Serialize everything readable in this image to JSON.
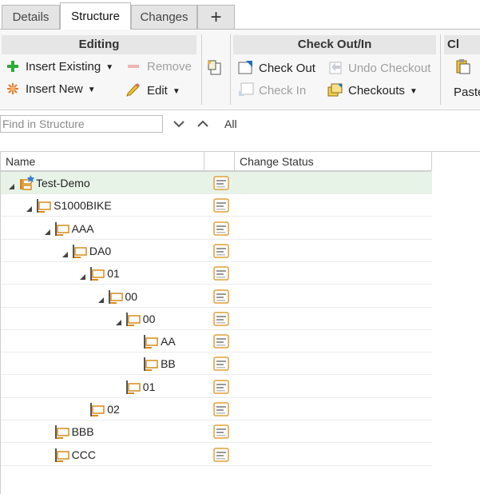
{
  "tabs": [
    {
      "label": "Details"
    },
    {
      "label": "Structure",
      "active": true
    },
    {
      "label": "Changes"
    },
    {
      "label": "+"
    }
  ],
  "ribbon": {
    "editing": {
      "title": "Editing",
      "insert_existing": "Insert Existing",
      "insert_new": "Insert New",
      "remove": "Remove",
      "edit": "Edit"
    },
    "checkout": {
      "title": "Check Out/In",
      "check_out": "Check Out",
      "check_in": "Check In",
      "undo_checkout": "Undo Checkout",
      "checkouts": "Checkouts"
    },
    "clipboard": {
      "title": "Cl",
      "paste": "Paste"
    }
  },
  "find": {
    "placeholder": "Find in Structure",
    "scope": "All"
  },
  "grid": {
    "columns": {
      "name": "Name",
      "change_status": "Change Status"
    },
    "rows": [
      {
        "label": "Test-Demo",
        "level": 0,
        "expanded": true,
        "root": true
      },
      {
        "label": "S1000BIKE",
        "level": 1,
        "expanded": true
      },
      {
        "label": "AAA",
        "level": 2,
        "expanded": true
      },
      {
        "label": "DA0",
        "level": 3,
        "expanded": true
      },
      {
        "label": "01",
        "level": 4,
        "expanded": true
      },
      {
        "label": "00",
        "level": 5,
        "expanded": true
      },
      {
        "label": "00",
        "level": 6,
        "expanded": true
      },
      {
        "label": "AA",
        "level": 7,
        "expanded": false
      },
      {
        "label": "BB",
        "level": 7,
        "expanded": false
      },
      {
        "label": "01",
        "level": 6,
        "expanded": false
      },
      {
        "label": "02",
        "level": 4,
        "expanded": false
      },
      {
        "label": "BBB",
        "level": 2,
        "expanded": false
      },
      {
        "label": "CCC",
        "level": 2,
        "expanded": false
      }
    ]
  },
  "colors": {
    "accent_green": "#2eaa3a",
    "folder_orange": "#d98b1b",
    "selected_row": "#e8f3e8"
  }
}
